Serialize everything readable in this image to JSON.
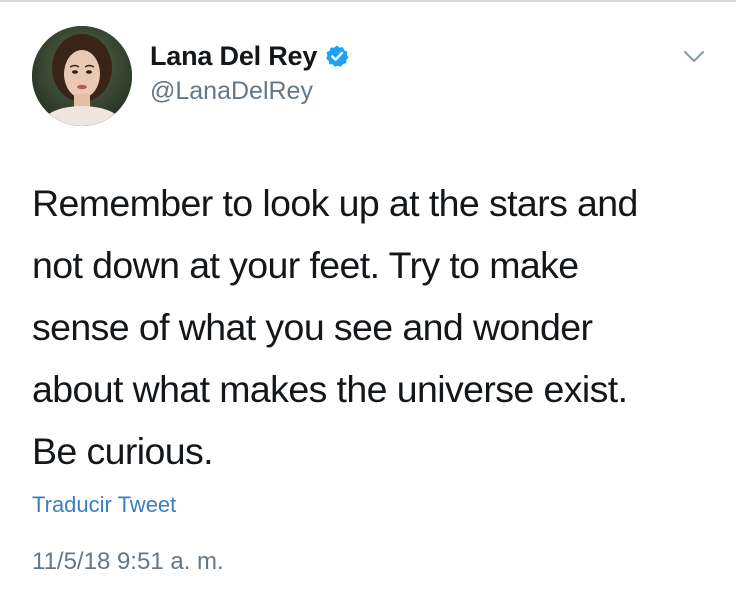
{
  "tweet": {
    "author": {
      "display_name": "Lana Del Rey",
      "handle": "@LanaDelRey",
      "verified": true,
      "avatar_icon": "profile-photo"
    },
    "menu_icon": "chevron-down-icon",
    "text": "Remember to look up at the stars and\nnot down at your feet. Try to make\nsense of what you see and wonder\nabout what makes the universe exist.\nBe curious.",
    "translate_label": "Traducir Tweet",
    "timestamp": "11/5/18 9:51 a. m."
  },
  "colors": {
    "text_primary": "#14171a",
    "text_secondary": "#657786",
    "link": "#3a7fc1",
    "verified": "#1da1f2"
  }
}
